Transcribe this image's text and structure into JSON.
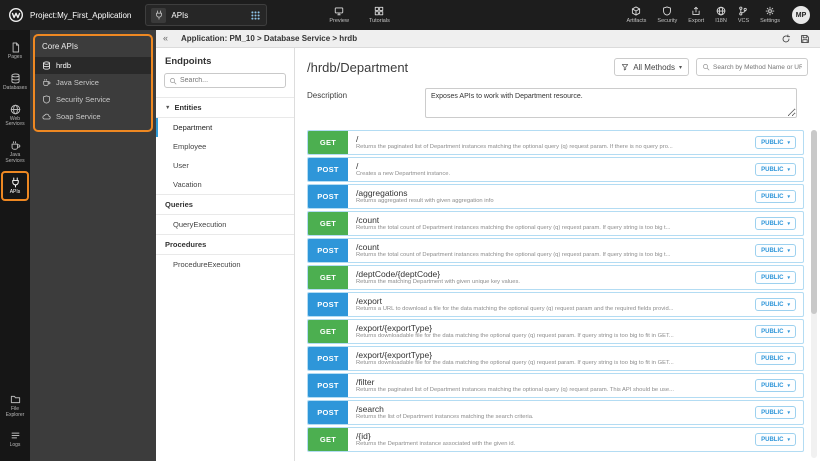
{
  "topbar": {
    "project_label": "Project:My_First_Application",
    "selector": {
      "icon": "api-plug-icon",
      "label": "APIs"
    },
    "center_items": [
      {
        "name": "preview",
        "icon": "monitor-icon",
        "label": "Preview"
      },
      {
        "name": "tutorials",
        "icon": "tutorials-icon",
        "label": "Tutorials"
      }
    ],
    "right_items": [
      {
        "name": "artifacts",
        "icon": "cube-icon",
        "label": "Artifacts"
      },
      {
        "name": "security",
        "icon": "shield-icon",
        "label": "Security"
      },
      {
        "name": "export",
        "icon": "export-icon",
        "label": "Export"
      },
      {
        "name": "i18n",
        "icon": "globe-icon",
        "label": "I18N"
      },
      {
        "name": "vcs",
        "icon": "branch-icon",
        "label": "VCS"
      },
      {
        "name": "settings",
        "icon": "gear-icon",
        "label": "Settings"
      }
    ],
    "avatar": "MP"
  },
  "rail": {
    "top_items": [
      {
        "name": "pages",
        "icon": "pages-icon",
        "label": "Pages",
        "active": false,
        "highlighted": false
      },
      {
        "name": "databases",
        "icon": "database-icon",
        "label": "Databases",
        "active": false,
        "highlighted": false
      },
      {
        "name": "web-services",
        "icon": "globe-icon",
        "label": "Web Services",
        "active": false,
        "highlighted": false
      },
      {
        "name": "java-services",
        "icon": "coffee-icon",
        "label": "Java Services",
        "active": false,
        "highlighted": false
      },
      {
        "name": "apis",
        "icon": "api-plug-icon",
        "label": "APIs",
        "active": true,
        "highlighted": true
      }
    ],
    "bottom_items": [
      {
        "name": "file-explorer",
        "icon": "folder-icon",
        "label": "File Explorer",
        "active": false,
        "highlighted": false
      },
      {
        "name": "logs",
        "icon": "logs-icon",
        "label": "Logs",
        "active": false,
        "highlighted": false
      }
    ]
  },
  "core_apis": {
    "title": "Core APIs",
    "items": [
      {
        "name": "hrdb",
        "icon": "database-icon",
        "label": "hrdb",
        "selected": true
      },
      {
        "name": "java-service",
        "icon": "coffee-icon",
        "label": "Java Service",
        "selected": false
      },
      {
        "name": "security-service",
        "icon": "shield-icon",
        "label": "Security Service",
        "selected": false
      },
      {
        "name": "soap-service",
        "icon": "soap-icon",
        "label": "Soap Service",
        "selected": false
      }
    ]
  },
  "breadcrumb": {
    "text": "Application: PM_10 > Database Service > hrdb"
  },
  "endpoints_panel": {
    "title": "Endpoints",
    "search_placeholder": "Search...",
    "sections": [
      {
        "title": "Entities",
        "collapsible": true,
        "items": [
          {
            "label": "Department",
            "selected": true
          },
          {
            "label": "Employee",
            "selected": false
          },
          {
            "label": "User",
            "selected": false
          },
          {
            "label": "Vacation",
            "selected": false
          }
        ]
      },
      {
        "title": "Queries",
        "collapsible": false,
        "items": [
          {
            "label": "QueryExecution",
            "selected": false
          }
        ]
      },
      {
        "title": "Procedures",
        "collapsible": false,
        "items": [
          {
            "label": "ProcedureExecution",
            "selected": false
          }
        ]
      }
    ]
  },
  "main": {
    "title": "/hrdb/Department",
    "methods_filter_label": "All Methods",
    "search_placeholder": "Search by Method Name or URL...",
    "description_label": "Description",
    "description_value": "Exposes APIs to work with Department resource.",
    "endpoints": [
      {
        "method": "GET",
        "path": "/",
        "desc": "Returns the paginated list of Department instances matching the optional query (q) request param. If there is no query pro...",
        "access": "PUBLIC"
      },
      {
        "method": "POST",
        "path": "/",
        "desc": "Creates a new Department instance.",
        "access": "PUBLIC"
      },
      {
        "method": "POST",
        "path": "/aggregations",
        "desc": "Returns aggregated result with given aggregation info",
        "access": "PUBLIC"
      },
      {
        "method": "GET",
        "path": "/count",
        "desc": "Returns the total count of Department instances matching the optional query (q) request param. If query string is too big t...",
        "access": "PUBLIC"
      },
      {
        "method": "POST",
        "path": "/count",
        "desc": "Returns the total count of Department instances matching the optional query (q) request param. If query string is too big t...",
        "access": "PUBLIC"
      },
      {
        "method": "GET",
        "path": "/deptCode/{deptCode}",
        "desc": "Returns the matching Department with given unique key values.",
        "access": "PUBLIC"
      },
      {
        "method": "POST",
        "path": "/export",
        "desc": "Returns a URL to download a file for the data matching the optional query (q) request param and the required fields provid...",
        "access": "PUBLIC"
      },
      {
        "method": "GET",
        "path": "/export/{exportType}",
        "desc": "Returns downloadable file for the data matching the optional query (q) request param. If query string is too big to fit in GET...",
        "access": "PUBLIC"
      },
      {
        "method": "POST",
        "path": "/export/{exportType}",
        "desc": "Returns downloadable file for the data matching the optional query (q) request param. If query string is too big to fit in GET...",
        "access": "PUBLIC"
      },
      {
        "method": "POST",
        "path": "/filter",
        "desc": "Returns the paginated list of Department instances matching the optional query (q) request param. This API should be use...",
        "access": "PUBLIC"
      },
      {
        "method": "POST",
        "path": "/search",
        "desc": "Returns the list of Department instances matching the search criteria.",
        "access": "PUBLIC"
      },
      {
        "method": "GET",
        "path": "/{id}",
        "desc": "Returns the Department instance associated with the given id.",
        "access": "PUBLIC"
      }
    ]
  },
  "colors": {
    "get_badge": "#4caf50",
    "post_badge": "#2e96d9",
    "highlight_orange": "#ee8822",
    "public_text": "#2f96d9",
    "row_border": "#b3dcf3",
    "topbar_bg": "#1d1d1d",
    "panel_bg": "#3c3c3c"
  }
}
